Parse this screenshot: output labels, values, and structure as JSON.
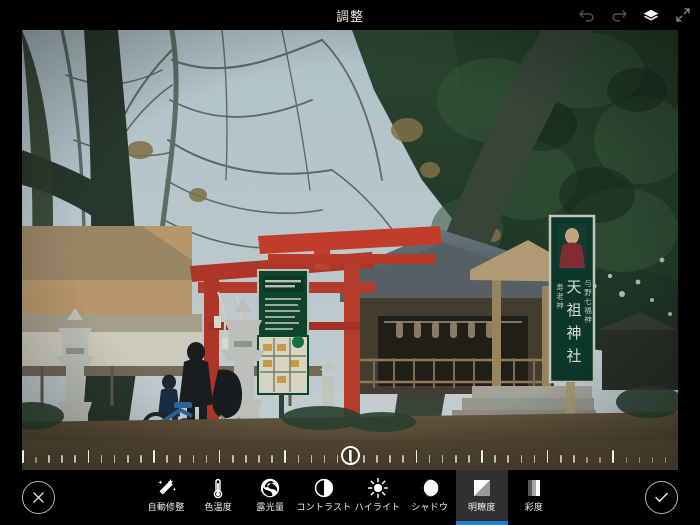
{
  "app": {
    "screen_title": "調整",
    "background_color": "#000000",
    "accent_color": "#1b7fd4"
  },
  "topbar": {
    "title": "調整",
    "actions": [
      {
        "name": "undo-icon",
        "label": "元に戻す",
        "enabled": false
      },
      {
        "name": "redo-icon",
        "label": "やり直す",
        "enabled": false
      },
      {
        "name": "layers-icon",
        "label": "レイヤー",
        "enabled": true
      },
      {
        "name": "expand-icon",
        "label": "全画面表示",
        "enabled": true
      }
    ]
  },
  "photo": {
    "alt": "天祖神社の鳥居と境内の写真",
    "sign_main_text": "天祖神社",
    "sign_sub_text_1": "与野七福神",
    "sign_sub_text_2": "寿老神"
  },
  "slider": {
    "name": "adjustment-slider",
    "value": "0",
    "min": "-100",
    "max": "100",
    "tick_count": "51",
    "handle_position_percent": "50"
  },
  "bottombar": {
    "cancel_label": "キャンセル",
    "confirm_label": "適用",
    "cancel_icon": "close-icon",
    "confirm_icon": "check-icon",
    "tools": [
      {
        "id": "auto",
        "label": "自動修整",
        "icon": "magic-wand-icon",
        "selected": false
      },
      {
        "id": "temp",
        "label": "色温度",
        "icon": "thermometer-icon",
        "selected": false
      },
      {
        "id": "exposure",
        "label": "露光量",
        "icon": "aperture-icon",
        "selected": false
      },
      {
        "id": "contrast",
        "label": "コントラスト",
        "icon": "contrast-icon",
        "selected": false
      },
      {
        "id": "highlight",
        "label": "ハイライト",
        "icon": "sun-icon",
        "selected": false
      },
      {
        "id": "shadow",
        "label": "シャドウ",
        "icon": "moon-icon",
        "selected": false
      },
      {
        "id": "clarity",
        "label": "明瞭度",
        "icon": "clarity-icon",
        "selected": true
      },
      {
        "id": "saturation",
        "label": "彩度",
        "icon": "saturation-icon",
        "selected": false
      }
    ]
  }
}
